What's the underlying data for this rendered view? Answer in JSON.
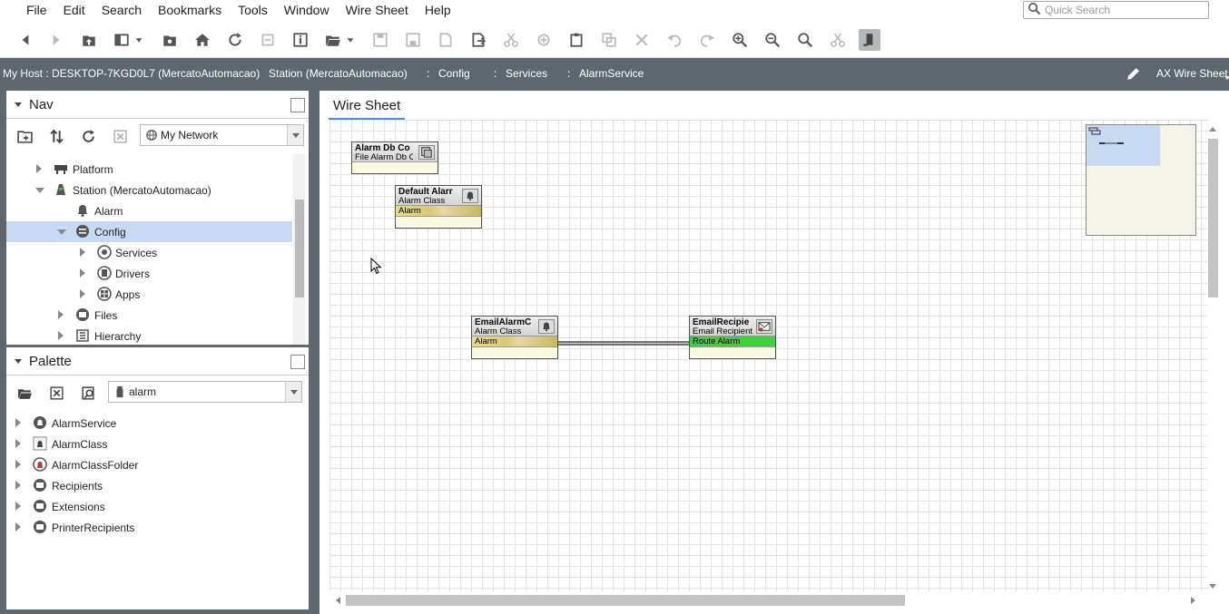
{
  "menu": [
    "File",
    "Edit",
    "Search",
    "Bookmarks",
    "Tools",
    "Window",
    "Wire Sheet",
    "Help"
  ],
  "quick_search": {
    "placeholder": "Quick Search",
    "icon": "search-icon"
  },
  "toolbar_icons": [
    "back-icon",
    "forward-icon",
    "up-level-icon",
    "side-bar-icon",
    "dropdown-arrow-icon",
    "new-tab-icon",
    "home-icon",
    "refresh-icon",
    "cancel-icon",
    "info-icon",
    "open-icon",
    "dropdown-arrow-icon",
    "save-icon",
    "save-all-icon",
    "save-as-icon",
    "export-icon",
    "cut-icon",
    "copy-icon",
    "paste-icon",
    "duplicate-icon",
    "delete-icon",
    "undo-icon",
    "redo-icon",
    "zoom-in-icon",
    "zoom-out-icon",
    "zoom-fit-icon",
    "wire-icon",
    "link-mode-icon"
  ],
  "breadcrumb": {
    "host": "My Host : DESKTOP-7KGD0L7 (MercatoAutomacao)",
    "items": [
      "Station (MercatoAutomacao)",
      "Config",
      "Services",
      "AlarmService"
    ],
    "separator": ":",
    "view": "AX Wire Sheet"
  },
  "nav": {
    "title": "Nav",
    "dropdown": "My Network",
    "tree": [
      {
        "label": "Platform",
        "state": "closed",
        "icon": "platform-icon"
      },
      {
        "label": "Station (MercatoAutomacao)",
        "state": "open",
        "icon": "station-icon"
      },
      {
        "label": "Alarm",
        "state": "none",
        "icon": "bell-icon"
      },
      {
        "label": "Config",
        "state": "open",
        "icon": "config-icon",
        "selected": true
      },
      {
        "label": "Services",
        "state": "closed",
        "icon": "services-icon"
      },
      {
        "label": "Drivers",
        "state": "closed",
        "icon": "drivers-icon"
      },
      {
        "label": "Apps",
        "state": "closed",
        "icon": "apps-icon"
      },
      {
        "label": "Files",
        "state": "closed",
        "icon": "files-icon"
      },
      {
        "label": "Hierarchy",
        "state": "closed",
        "icon": "hierarchy-icon"
      }
    ]
  },
  "palette": {
    "title": "Palette",
    "dropdown": "alarm",
    "items": [
      "AlarmService",
      "AlarmClass",
      "AlarmClassFolder",
      "Recipients",
      "Extensions",
      "PrinterRecipients"
    ]
  },
  "main": {
    "tab": "Wire Sheet",
    "components": [
      {
        "name": "Alarm Db Co",
        "type": "File Alarm Db C",
        "slot": "",
        "icon": "database-icon"
      },
      {
        "name": "Default Alarr",
        "type": "Alarm Class",
        "slot": "Alarm",
        "icon": "bell-icon"
      },
      {
        "name": "EmailAlarmC",
        "type": "Alarm Class",
        "slot": "Alarm",
        "icon": "bell-icon"
      },
      {
        "name": "EmailRecipie",
        "type": "Email Recipient",
        "slot": "Route Alarm",
        "icon": "email-icon"
      }
    ]
  },
  "colors": {
    "selection": "#c7daf4",
    "header_bar": "#5e6770",
    "slot_active": "#40cf40"
  }
}
